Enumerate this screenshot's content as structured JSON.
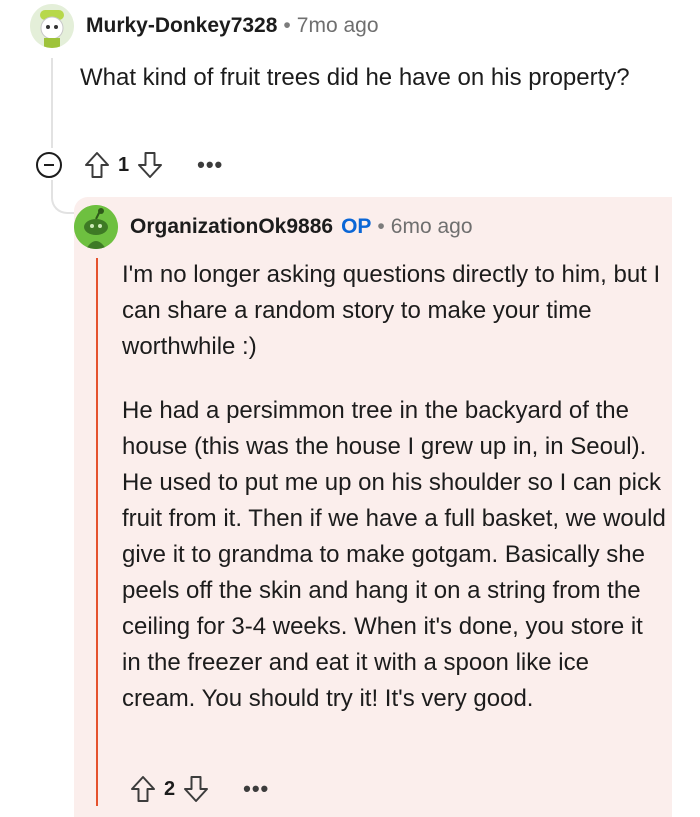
{
  "parent_comment": {
    "username": "Murky-Donkey7328",
    "separator": "•",
    "time": "7mo ago",
    "body": "What kind of fruit trees did he have on his property?",
    "score": "1",
    "more": "•••",
    "avatar_icon": "snoo-avatar-icon"
  },
  "reply_comment": {
    "username": "OrganizationOk9886",
    "op_badge": "OP",
    "separator": "•",
    "time": "6mo ago",
    "paragraphs": [
      "I'm no longer asking questions directly to him, but I can share a random story to make your time worthwhile :)",
      "He had a persimmon tree in the backyard of the house (this was the house I grew up in, in Seoul). He used to put me up on his shoulder so I can pick fruit from it. Then if we have a full basket, we would give it to grandma to make gotgam. Basically she peels off the skin and hang it on a string from the ceiling for 3-4 weeks. When it's done, you store it in the freezer and eat it with a spoon like ice cream. You should try it! It's very good."
    ],
    "score": "2",
    "more": "•••",
    "avatar_icon": "snoo-avatar-icon"
  },
  "colors": {
    "op": "#0a66d6",
    "reply_background": "#fbeeec",
    "reply_bar": "#e5522e"
  }
}
